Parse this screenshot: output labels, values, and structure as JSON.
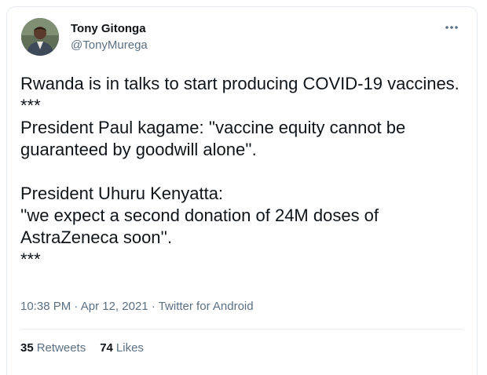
{
  "tweet": {
    "author_name": "Tony Gitonga",
    "author_handle": "@TonyMurega",
    "text": "Rwanda is in talks to start producing COVID-19 vaccines.\n***\nPresident Paul kagame: ''vaccine equity cannot be guaranteed by goodwill alone''.\n\nPresident Uhuru Kenyatta:\n''we expect a second donation of 24M doses of AstraZeneca soon''.\n***",
    "time": "10:38 PM",
    "separator": "·",
    "date": "Apr 12, 2021",
    "source": "Twitter for Android",
    "retweets_count": "35",
    "retweets_label": "Retweets",
    "likes_count": "74",
    "likes_label": "Likes"
  },
  "icons": {
    "more": "more-horizontal-icon",
    "avatar": "profile-photo"
  },
  "colors": {
    "primary_text": "#0f1419",
    "secondary_text": "#5b7083",
    "border": "#e6ecf0",
    "accent": "#1da1f2"
  }
}
